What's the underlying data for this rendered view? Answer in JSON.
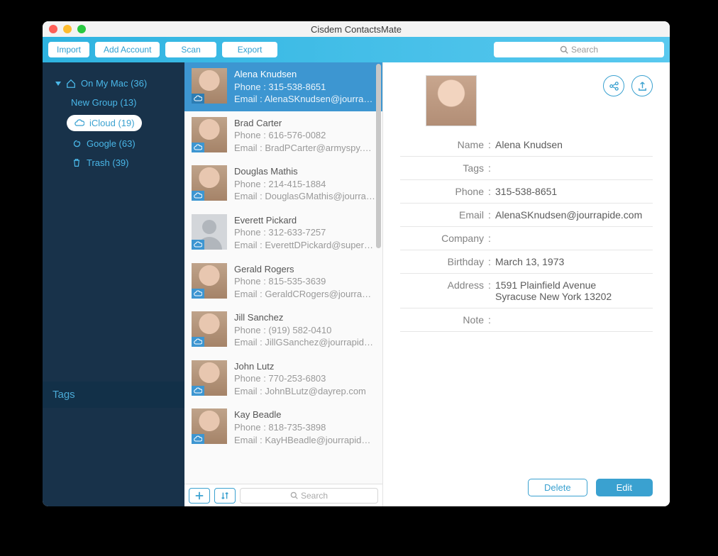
{
  "window_title": "Cisdem ContactsMate",
  "toolbar": {
    "import": "Import",
    "add_account": "Add Account",
    "scan": "Scan",
    "export": "Export",
    "search_placeholder": "Search"
  },
  "sidebar": {
    "on_my_mac": "On My Mac (36)",
    "new_group": "New Group (13)",
    "icloud": "iCloud (19)",
    "google": "Google (63)",
    "trash": "Trash (39)",
    "tags": "Tags"
  },
  "contacts": [
    {
      "name": "Alena Knudsen",
      "phone": "315-538-8651",
      "email": "AlenaSKnudsen@jourrapide..",
      "selected": true
    },
    {
      "name": "Brad Carter",
      "phone": "616-576-0082",
      "email": "BradPCarter@armyspy.com"
    },
    {
      "name": "Douglas Mathis",
      "phone": "214-415-1884",
      "email": "DouglasGMathis@jourrapid..."
    },
    {
      "name": "Everett Pickard",
      "phone": "312-633-7257",
      "email": "EverettDPickard@superrito....",
      "placeholder": true
    },
    {
      "name": "Gerald Rogers",
      "phone": "815-535-3639",
      "email": "GeraldCRogers@jourrapide...."
    },
    {
      "name": "Jill Sanchez",
      "phone": "(919) 582-0410",
      "email": "JillGSanchez@jourrapide.com"
    },
    {
      "name": "John Lutz",
      "phone": "770-253-6803",
      "email": "JohnBLutz@dayrep.com"
    },
    {
      "name": "Kay Beadle",
      "phone": "818-735-3898",
      "email": "KayHBeadle@jourrapide.com"
    }
  ],
  "list_footer": {
    "search_placeholder": "Search"
  },
  "detail": {
    "labels": {
      "name": "Name",
      "tags": "Tags",
      "phone": "Phone",
      "email": "Email",
      "company": "Company",
      "birthday": "Birthday",
      "address": "Address",
      "note": "Note"
    },
    "values": {
      "name": "Alena Knudsen",
      "tags": "",
      "phone": "315-538-8651",
      "email": "AlenaSKnudsen@jourrapide.com",
      "company": "",
      "birthday": "March 13, 1973",
      "address_line1": "1591 Plainfield Avenue",
      "address_line2": "Syracuse New York 13202",
      "note": ""
    },
    "phone_prefix": "Phone : ",
    "email_prefix": "Email : ",
    "delete": "Delete",
    "edit": "Edit"
  }
}
